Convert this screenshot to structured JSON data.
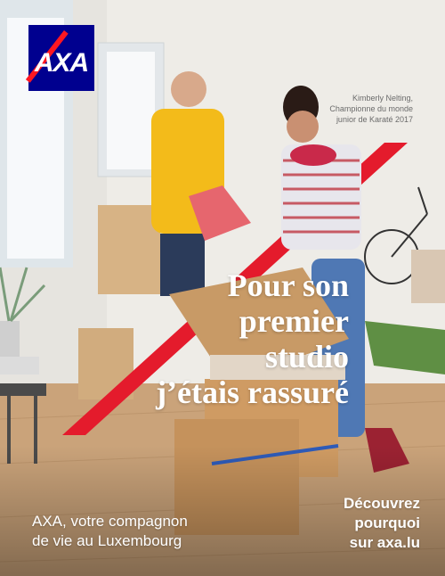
{
  "brand": {
    "logo_text": "AXA"
  },
  "caption": {
    "line1": "Kimberly Nelting,",
    "line2": "Championne du monde",
    "line3": "junior de Karaté 2017"
  },
  "headline": {
    "line1": "Pour son",
    "line2": "premier",
    "line3": "studio",
    "line4": "j’étais rassuré"
  },
  "tagline": {
    "line1": "AXA, votre compagnon",
    "line2": "de vie au Luxembourg"
  },
  "cta": {
    "line1": "Découvrez",
    "line2": "pourquoi",
    "line3": "sur axa.lu"
  },
  "colors": {
    "brand_blue": "#00008f",
    "brand_red": "#ff1721"
  }
}
